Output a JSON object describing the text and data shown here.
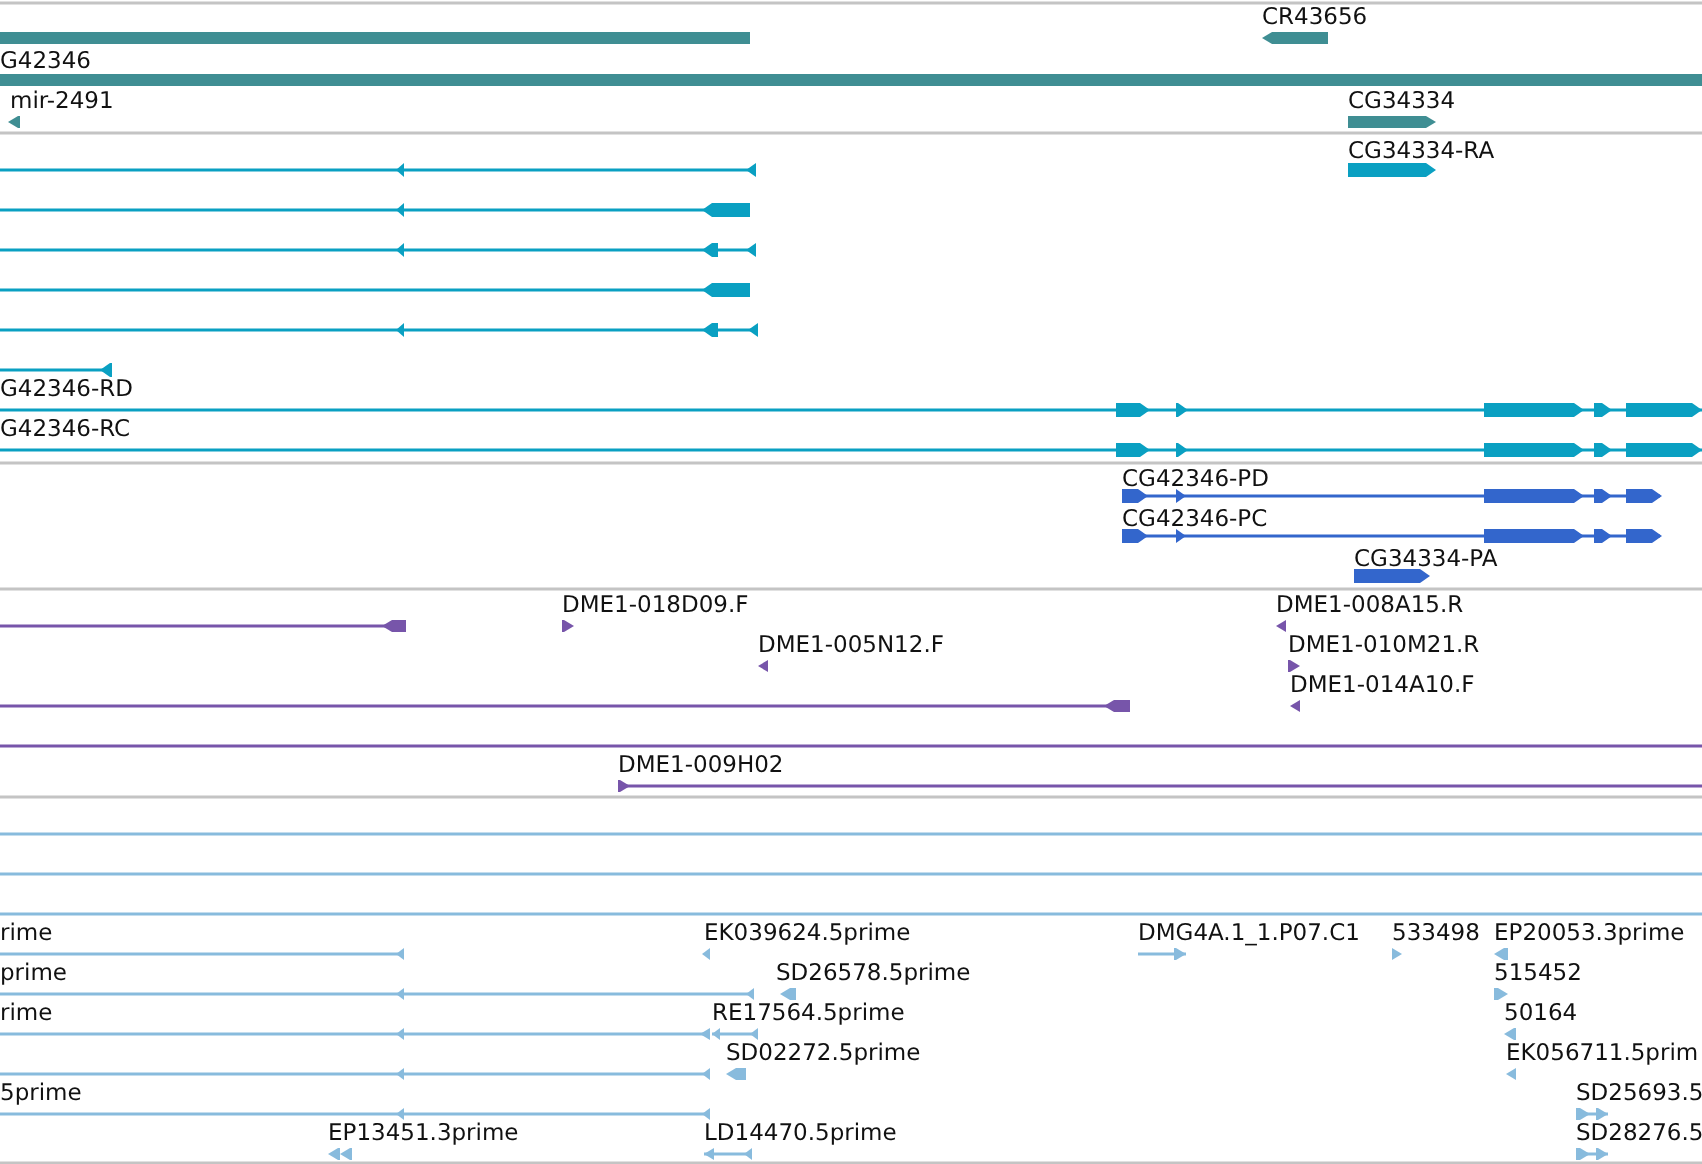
{
  "tracks": [
    {
      "kind": "gene",
      "features": [
        {
          "kind": "block"
        },
        {
          "label": "CR43656",
          "kind": "reverse"
        },
        {
          "label": "G42346",
          "kind": "block"
        },
        {
          "label": "mir-2491",
          "kind": "reverse"
        },
        {
          "label": "CG34334",
          "kind": "forward"
        }
      ]
    },
    {
      "kind": "mrna",
      "features": [
        {
          "label": "CG34334-RA",
          "kind": "forward"
        },
        {
          "kind": "reverse"
        },
        {
          "kind": "reverse"
        },
        {
          "kind": "reverse"
        },
        {
          "kind": "reverse"
        },
        {
          "kind": "reverse"
        },
        {
          "kind": "reverse"
        },
        {
          "label": "G42346-RD",
          "kind": "forward"
        },
        {
          "label": "G42346-RC",
          "kind": "forward"
        }
      ]
    },
    {
      "kind": "protein",
      "features": [
        {
          "label": "CG42346-PD",
          "kind": "forward"
        },
        {
          "label": "CG42346-PC",
          "kind": "forward"
        },
        {
          "label": "CG34334-PA",
          "kind": "forward"
        }
      ]
    },
    {
      "kind": "clone",
      "features": [
        {
          "kind": "reverse"
        },
        {
          "label": "DME1-018D09.F",
          "kind": "forward"
        },
        {
          "label": "DME1-008A15.R",
          "kind": "reverse"
        },
        {
          "label": "DME1-005N12.F",
          "kind": "reverse"
        },
        {
          "label": "DME1-010M21.R",
          "kind": "forward"
        },
        {
          "kind": "reverse"
        },
        {
          "label": "DME1-014A10.F",
          "kind": "reverse"
        },
        {
          "kind": "block"
        },
        {
          "label": "DME1-009H02",
          "kind": "forward"
        }
      ]
    },
    {
      "kind": "est",
      "features": [
        {
          "kind": "block"
        },
        {
          "kind": "block"
        },
        {
          "kind": "block"
        },
        {
          "label": "rime",
          "kind": "reverse"
        },
        {
          "label": "EK039624.5prime",
          "kind": "reverse"
        },
        {
          "label": "DMG4A.1_1.P07.C1",
          "kind": "forward"
        },
        {
          "label": "533498",
          "kind": "forward"
        },
        {
          "label": "EP20053.3prime",
          "kind": "reverse"
        },
        {
          "label": "prime",
          "kind": "reverse"
        },
        {
          "label": "SD26578.5prime",
          "kind": "reverse"
        },
        {
          "label": "515452",
          "kind": "forward"
        },
        {
          "label": "rime",
          "kind": "reverse"
        },
        {
          "label": "RE17564.5prime",
          "kind": "reverse"
        },
        {
          "label": "50164",
          "kind": "reverse"
        },
        {
          "kind": "reverse"
        },
        {
          "label": "SD02272.5prime",
          "kind": "reverse"
        },
        {
          "label": "EK056711.5prim",
          "kind": "reverse"
        },
        {
          "label": "5prime",
          "kind": "reverse"
        },
        {
          "label": "SD25693.5",
          "kind": "forward"
        },
        {
          "label": "EP13451.3prime",
          "kind": "reverse"
        },
        {
          "label": "LD14470.5prime",
          "kind": "reverse"
        },
        {
          "label": "SD28276.5",
          "kind": "forward"
        }
      ]
    }
  ]
}
